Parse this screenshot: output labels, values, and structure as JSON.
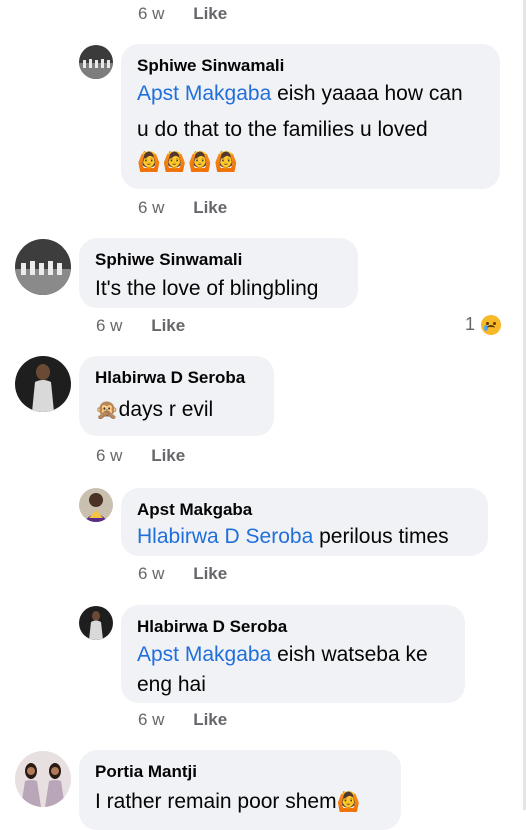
{
  "comments": [
    {
      "id": "c0",
      "time": "6 w",
      "like": "Like"
    },
    {
      "id": "c1",
      "author": "Sphiwe Sinwamali",
      "mention": "Apst Makgaba",
      "line1": " eish yaaaa how can",
      "line2": "u do that to the families u loved",
      "emoji_line": "🙆🙆🙆🙆",
      "time": "6 w",
      "like": "Like"
    },
    {
      "id": "c2",
      "author": "Sphiwe Sinwamali",
      "text": "It's the love of blingbling",
      "time": "6 w",
      "like": "Like",
      "reaction_count": "1",
      "reaction_icon": "sad-reaction-icon"
    },
    {
      "id": "c3",
      "author": "Hlabirwa D Seroba",
      "emoji": "🙊",
      "text": "days r evil",
      "time": "6 w",
      "like": "Like"
    },
    {
      "id": "c4",
      "author": "Apst Makgaba",
      "mention": "Hlabirwa D Seroba",
      "text": " perilous times",
      "time": "6 w",
      "like": "Like"
    },
    {
      "id": "c5",
      "author": "Hlabirwa D Seroba",
      "mention": "Apst Makgaba",
      "line1": " eish watseba ke",
      "line2": "eng hai",
      "time": "6 w",
      "like": "Like"
    },
    {
      "id": "c6",
      "author": "Portia Mantji",
      "text": "I rather remain poor shem",
      "emoji": "🙆"
    }
  ]
}
